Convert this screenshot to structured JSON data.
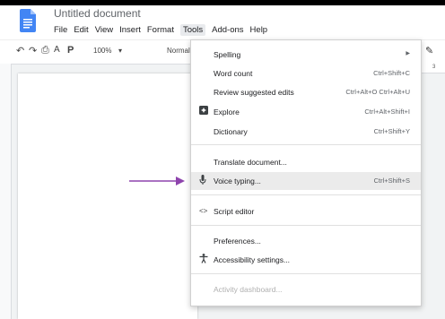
{
  "document": {
    "title": "Untitled document"
  },
  "menubar": [
    "File",
    "Edit",
    "View",
    "Insert",
    "Format",
    "Tools",
    "Add-ons",
    "Help"
  ],
  "toolbar": {
    "zoom": "100%",
    "style": "Normal"
  },
  "ruler": {
    "mark": "3"
  },
  "tools_menu": {
    "items": [
      {
        "label": "Spelling",
        "shortcut": "",
        "submenu": true
      },
      {
        "label": "Word count",
        "shortcut": "Ctrl+Shift+C"
      },
      {
        "label": "Review suggested edits",
        "shortcut": "Ctrl+Alt+O Ctrl+Alt+U"
      },
      {
        "label": "Explore",
        "shortcut": "Ctrl+Alt+Shift+I",
        "icon": "explore-icon"
      },
      {
        "label": "Dictionary",
        "shortcut": "Ctrl+Shift+Y"
      },
      {
        "label": "Translate document...",
        "shortcut": ""
      },
      {
        "label": "Voice typing...",
        "shortcut": "Ctrl+Shift+S",
        "icon": "microphone-icon"
      },
      {
        "label": "Script editor",
        "shortcut": "",
        "icon": "code-icon"
      },
      {
        "label": "Preferences...",
        "shortcut": ""
      },
      {
        "label": "Accessibility settings...",
        "shortcut": "",
        "icon": "accessibility-icon"
      },
      {
        "label": "Activity dashboard...",
        "shortcut": "",
        "disabled": true
      }
    ]
  },
  "colors": {
    "arrow": "#8e44ad",
    "highlight": "#ebebeb"
  }
}
